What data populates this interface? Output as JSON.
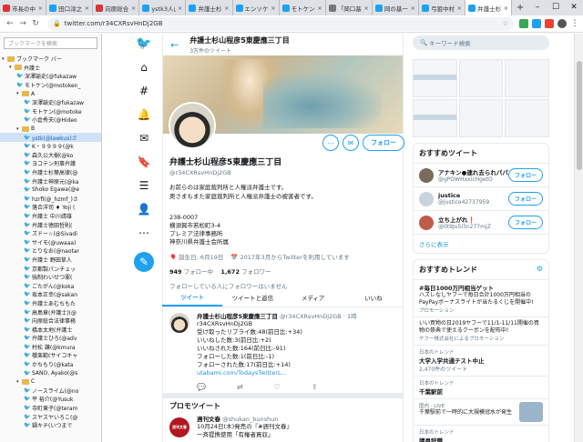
{
  "tabs": [
    {
      "title": "市長の中",
      "color": "#d33"
    },
    {
      "title": "田口淳之",
      "color": "#1da1f2"
    },
    {
      "title": "向原総合",
      "color": "#d33"
    },
    {
      "title": "ystk3人山",
      "color": "#1da1f2"
    },
    {
      "title": "弁護士杉",
      "color": "#1da1f2"
    },
    {
      "title": "エンソケ系",
      "color": "#1da1f2"
    },
    {
      "title": "モトケン(",
      "color": "#1da1f2"
    },
    {
      "title": "「岡口基",
      "color": "#777"
    },
    {
      "title": "岡の基一",
      "color": "#1da1f2"
    },
    {
      "title": "弓狙中村",
      "color": "#1da1f2"
    },
    {
      "title": "弁護士杉",
      "color": "#1da1f2",
      "active": true
    }
  ],
  "address": {
    "url": "twitter.com/r34CXRsvHnDj2GB"
  },
  "bookmarks": {
    "search_placeholder": "ブックマークを検索",
    "items": [
      {
        "label": "ブックマーク バー",
        "type": "folder",
        "indent": 0
      },
      {
        "label": "弁護士",
        "type": "folder",
        "indent": 1
      },
      {
        "label": "深澤諭史(@fukazaw",
        "type": "tw",
        "indent": 2
      },
      {
        "label": "モトケン(@motoken_",
        "type": "tw",
        "indent": 2
      },
      {
        "label": "A",
        "type": "folder",
        "indent": 2
      },
      {
        "label": "深澤諭史(@fukazaw",
        "type": "tw",
        "indent": 3
      },
      {
        "label": "モトケン(@motoke",
        "type": "tw",
        "indent": 3
      },
      {
        "label": "小倉秀夫(@Hideo",
        "type": "tw",
        "indent": 3
      },
      {
        "label": "B",
        "type": "folder",
        "indent": 2
      },
      {
        "label": "ystk(@lawkus)さ",
        "type": "tw",
        "indent": 3,
        "sel": true
      },
      {
        "label": "K・９９９９(@k",
        "type": "tw",
        "indent": 3
      },
      {
        "label": "森久公大樹(@ko",
        "type": "tw",
        "indent": 3
      },
      {
        "label": "ヨコテン刑事弁護",
        "type": "tw",
        "indent": 3
      },
      {
        "label": "弁護士杉葉高律(@",
        "type": "tw",
        "indent": 3
      },
      {
        "label": "弁護士神原元(@ka",
        "type": "tw",
        "indent": 3
      },
      {
        "label": "Shoko Egawa(@e",
        "type": "tw",
        "indent": 3
      },
      {
        "label": "hzrfl(@_hzmf_)さ",
        "type": "tw",
        "indent": 3
      },
      {
        "label": "落合洋司 ♦ Yoji (",
        "type": "tw",
        "indent": 3
      },
      {
        "label": "弁護士 中川靖雄",
        "type": "tw",
        "indent": 3
      },
      {
        "label": "弁護士徳田哲則(",
        "type": "tw",
        "indent": 3
      },
      {
        "label": "ズドー☆(@Sivadi",
        "type": "tw",
        "indent": 3
      },
      {
        "label": "サイモ(@uwaaa)",
        "type": "tw",
        "indent": 3
      },
      {
        "label": "とりなお(@naotar",
        "type": "tw",
        "indent": 3
      },
      {
        "label": "弁護士 野田草人",
        "type": "tw",
        "indent": 3
      },
      {
        "label": "京都製パンチェッ",
        "type": "tw",
        "indent": 3
      },
      {
        "label": "強制わいせつ罪(",
        "type": "tw",
        "indent": 3
      },
      {
        "label": "ごたがん(@koka",
        "type": "tw",
        "indent": 3
      },
      {
        "label": "坂本正幸(@sakan",
        "type": "tw",
        "indent": 3
      },
      {
        "label": "弁護士あむちもた",
        "type": "tw",
        "indent": 3
      },
      {
        "label": "高島章(弁護士)(@",
        "type": "tw",
        "indent": 3
      },
      {
        "label": "向原総合法律事務",
        "type": "tw",
        "indent": 3
      },
      {
        "label": "橋本太地(弁護士",
        "type": "tw",
        "indent": 3
      },
      {
        "label": "弁護士ひろ(@adv",
        "type": "tw",
        "indent": 3
      },
      {
        "label": "村松 謙(@kmura",
        "type": "tw",
        "indent": 3
      },
      {
        "label": "櫻楽範(サイコキャ",
        "type": "tw",
        "indent": 3
      },
      {
        "label": "かちもり(@kata",
        "type": "tw",
        "indent": 3
      },
      {
        "label": "SANO, Ayako(@s",
        "type": "tw",
        "indent": 3
      },
      {
        "label": "C",
        "type": "folder",
        "indent": 2
      },
      {
        "label": "ノースライム(@no",
        "type": "tw",
        "indent": 3
      },
      {
        "label": "平 裕介(@Yusuk",
        "type": "tw",
        "indent": 3
      },
      {
        "label": "寺町東子(@teram",
        "type": "tw",
        "indent": 3
      },
      {
        "label": "スヤスヤいろこ(@",
        "type": "tw",
        "indent": 3
      },
      {
        "label": "鍋キチ(いつまで",
        "type": "tw",
        "indent": 3
      }
    ]
  },
  "profile": {
    "header_name": "弁護士杉山程彦5東慶應三丁目",
    "header_sub": "3万件のツイート",
    "name": "弁護士杉山程彦5東慶應三丁目",
    "handle": "@r34CXRsvHnDj2GB",
    "bio_1": "お前らのは家庭裁判所と人権派弁護士です。",
    "bio_2": "奥さまもまた家庭裁判所と人権派弁護士の被害者です。",
    "addr_1": "238-0007",
    "addr_2": "横須賀市若松町3-4",
    "addr_3": "プレミア法律事務所",
    "addr_4": "神奈川県弁護士会所属",
    "birthday": "誕生日: 6月19日",
    "joined": "2017年3月からTwitterを利用しています",
    "following_count": "949",
    "following_label": "フォロー中",
    "followers_count": "1,672",
    "followers_label": "フォロワー",
    "no_follow": "フォローしている人にフォロワーはいません",
    "follow_btn": "フォロー"
  },
  "profile_tabs": [
    "ツイート",
    "ツイートと返信",
    "メディア",
    "いいね"
  ],
  "tweet": {
    "name": "弁護士杉山程彦5東慶應三丁目",
    "handle": "@r34CXRsvHnDj2GB · 1時",
    "line_1": "r34CXRsvHnDj2GB",
    "line_2": "受け取ったリプライ数:48(前日比:+34)",
    "line_3": "いいねした数:3(前日比:+2)",
    "line_4": "いいねされた数:164(前日比:-91)",
    "line_5": "フォローした数:1(前日比:-1)",
    "line_6": "フォローされた数:17(前日比:+14)",
    "link": "utabami.com/TodaysTwitterL..."
  },
  "promo": {
    "heading": "プロモツイート",
    "name": "週刊文春",
    "handle": "@shukan_bunshun",
    "line_1": "10月24日(木)発売の『#週刊文春』",
    "line_2": "一斉提携使用「有権者買収」",
    "avatar_text": "週刊文春"
  },
  "right": {
    "search_placeholder": "キーワード検索",
    "who_title": "おすすめツイート",
    "who": [
      {
        "name": "アナキン●連れ去られパパ",
        "handle": "@gPOWHxxicHgetO",
        "color": "#7a6a5a"
      },
      {
        "name": "justice",
        "handle": "@justice42737959",
        "color": "#c9d3db"
      },
      {
        "name": "立ち上がれ❗",
        "handle": "@0t9Ju5l3n277mjZ",
        "color": "#c05a4a"
      }
    ],
    "follow_btn": "フォロー",
    "more": "さらに表示",
    "trends_title": "おすすめトレンド",
    "trends": [
      {
        "name": "#毎日1000万円相当ゲット",
        "desc": "ハズレなしヤフーで毎日合計1000万円相当のPayPayボーナスライトが当たるくじを開催中!",
        "label": "プロモーション"
      },
      {
        "name": "",
        "desc": "いい買物の日2019ヤフーで11/1-11/11開催の買物の祭典で使えるクーポンを配布中!",
        "label": "ヤフー株式会社によるプロモーション"
      },
      {
        "name": "大学入学共通テスト中止",
        "desc": "",
        "label": "日本のトレンド",
        "count": "2,470件のツイート"
      },
      {
        "name": "千葉駅前",
        "desc": "",
        "label": "日本のトレンド"
      },
      {
        "name": "",
        "desc": "千葉駅前で一時的に大規模冠水が発生",
        "label": "国内 · LIVE"
      },
      {
        "name": "議員辞職",
        "desc": "",
        "label": "日本のトレンド"
      }
    ]
  }
}
